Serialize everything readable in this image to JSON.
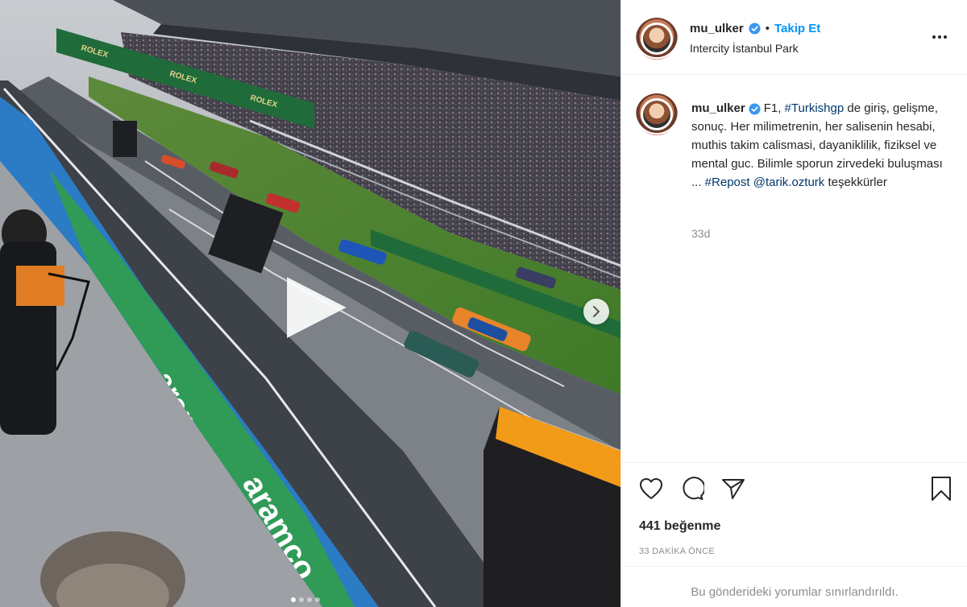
{
  "post": {
    "username": "mu_ulker",
    "follow_label": "Takip Et",
    "separator": "•",
    "location": "Intercity İstanbul Park",
    "caption": {
      "part1": "F1, ",
      "hashtag1": "#Turkishgp",
      "part2": " de giriş, gelişme, sonuç. Her milimetrenin, her salisenin hesabi, muthis takim calismasi, dayaniklilik, fiziksel ve mental guc. Bilimle sporun zirvedeki buluşması ... ",
      "hashtag2": "#Repost",
      "mention": "@tarik.ozturk",
      "part3": " teşekkürler"
    },
    "time_ago": "33d",
    "likes": "441 beğenme",
    "posted_ago": "33 DAKİKA ÖNCE",
    "comments_notice": "Bu gönderideki yorumlar sınırlandırıldı."
  },
  "media": {
    "type": "video",
    "carousel_count": 4,
    "carousel_active": 1,
    "banner_text": "ROLEX",
    "wall_text": "aramco"
  },
  "icons": {
    "verified": "verified-badge-icon",
    "more": "more-options-icon",
    "like": "heart-icon",
    "comment": "comment-bubble-icon",
    "share": "paper-plane-icon",
    "save": "bookmark-icon",
    "play": "play-icon",
    "next": "chevron-right-icon"
  },
  "colors": {
    "link": "#0095f6",
    "hashtag": "#00376b",
    "muted": "#8e8e8e",
    "verified": "#3897f0"
  }
}
